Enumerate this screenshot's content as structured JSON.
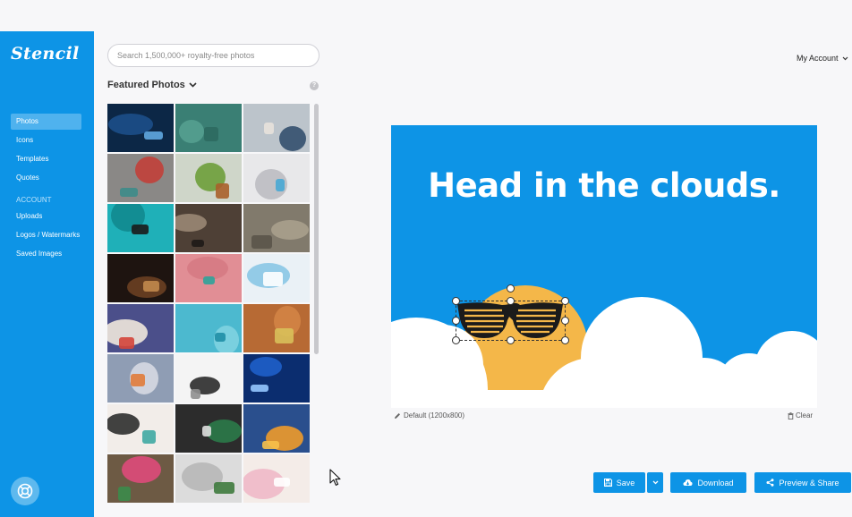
{
  "app": {
    "logo": "Stencil"
  },
  "sidebar": {
    "items": [
      {
        "label": "Photos",
        "active": true
      },
      {
        "label": "Icons",
        "active": false
      },
      {
        "label": "Templates",
        "active": false
      },
      {
        "label": "Quotes",
        "active": false
      }
    ],
    "account_heading": "ACCOUNT",
    "account_items": [
      {
        "label": "Uploads"
      },
      {
        "label": "Logos / Watermarks"
      },
      {
        "label": "Saved Images"
      }
    ],
    "help_icon": "lifebuoy-icon"
  },
  "search": {
    "placeholder": "Search 1,500,000+ royalty-free photos",
    "value": ""
  },
  "photos": {
    "title": "Featured Photos",
    "help_icon": "question-icon",
    "thumbnails": [
      {
        "subject": "blue butterflies on night grass",
        "colors": [
          "#0c2746",
          "#1c4f88",
          "#5fa8e0"
        ]
      },
      {
        "subject": "teal brick wall",
        "colors": [
          "#3a7f74",
          "#55a090",
          "#2d6a60"
        ]
      },
      {
        "subject": "man with laptop",
        "colors": [
          "#bcc4cb",
          "#33506e",
          "#e7e2dc"
        ]
      },
      {
        "subject": "paint jars",
        "colors": [
          "#8a8886",
          "#c1403a",
          "#3d8c8a"
        ]
      },
      {
        "subject": "drinks and snacks",
        "colors": [
          "#cfd6c9",
          "#6d9e3a",
          "#a8612a"
        ]
      },
      {
        "subject": "desk with computer",
        "colors": [
          "#e8e8ea",
          "#bdbdc2",
          "#48a8d4"
        ]
      },
      {
        "subject": "turntable on teal",
        "colors": [
          "#1fb0b8",
          "#11898f",
          "#1b1b1b"
        ]
      },
      {
        "subject": "hands on desk with laptop",
        "colors": [
          "#4e4036",
          "#9a8774",
          "#1e1a17"
        ]
      },
      {
        "subject": "cat on stone street",
        "colors": [
          "#817a6c",
          "#a9a08d",
          "#5a544a"
        ]
      },
      {
        "subject": "woman with lights",
        "colors": [
          "#1e1410",
          "#6a3f22",
          "#c18a4c"
        ]
      },
      {
        "subject": "pink flatlay",
        "colors": [
          "#e18e95",
          "#d67a83",
          "#2fa39a"
        ]
      },
      {
        "subject": "blue cup with flowers",
        "colors": [
          "#eaf1f6",
          "#89c7e5",
          "#ffffff"
        ]
      },
      {
        "subject": "card with fruit",
        "colors": [
          "#4b4f8a",
          "#f0e7dc",
          "#d4453a"
        ]
      },
      {
        "subject": "blue flower",
        "colors": [
          "#4cb9cf",
          "#7fd3e0",
          "#1f8ea6"
        ]
      },
      {
        "subject": "wooden table notebook",
        "colors": [
          "#b76a34",
          "#d38445",
          "#d8c05a"
        ]
      },
      {
        "subject": "sunset drink",
        "colors": [
          "#8f9db4",
          "#d6d9e2",
          "#e07b3a"
        ]
      },
      {
        "subject": "laptop on pattern",
        "colors": [
          "#f4f4f4",
          "#2b2b2b",
          "#8f8f8f"
        ]
      },
      {
        "subject": "light bulb",
        "colors": [
          "#0b2d6f",
          "#1e5fc9",
          "#93c7ff"
        ]
      },
      {
        "subject": "glasses and 2018 card",
        "colors": [
          "#f2ede9",
          "#2d2d2d",
          "#3fa9a3"
        ]
      },
      {
        "subject": "football player",
        "colors": [
          "#2c2c2c",
          "#2b7a49",
          "#dedede"
        ]
      },
      {
        "subject": "orange flowers on blue",
        "colors": [
          "#2a4f8d",
          "#ee9a2a",
          "#f7c04a"
        ]
      },
      {
        "subject": "pink flower on book",
        "colors": [
          "#6d5a44",
          "#de4a7b",
          "#3b8b4b"
        ]
      },
      {
        "subject": "clipboard and plant",
        "colors": [
          "#dcdcdc",
          "#b7b7b7",
          "#3e7a3d"
        ]
      },
      {
        "subject": "pink mug and cookies",
        "colors": [
          "#f4ece8",
          "#f0b9c8",
          "#ffffff"
        ]
      }
    ]
  },
  "header": {
    "account_label": "My Account"
  },
  "canvas": {
    "headline": "Head in the clouds.",
    "size_label": "Default (1200x800)",
    "clear_label": "Clear",
    "background_color": "#0d94e6",
    "sun_color": "#f4b749",
    "cloud_color": "#ffffff"
  },
  "toolbar": {
    "save_label": "Save",
    "download_label": "Download",
    "preview_label": "Preview & Share"
  },
  "colors": {
    "accent": "#0d94e6"
  }
}
